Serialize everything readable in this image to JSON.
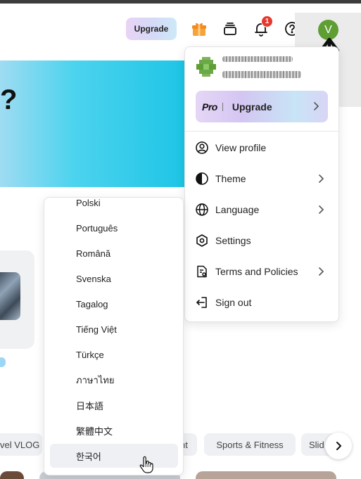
{
  "header": {
    "upgrade_label": "Upgrade",
    "notification_count": "1",
    "avatar_initial": "V",
    "icons": [
      "gift-icon",
      "wallet-icon",
      "bell-icon",
      "help-icon"
    ]
  },
  "background": {
    "hero_fragment": "?",
    "chips": [
      "vel VLOG",
      "nt",
      "Sports & Fitness",
      "Slid"
    ]
  },
  "profile_menu": {
    "pro_card": {
      "pro_label": "Pro",
      "upgrade_label": "Upgrade"
    },
    "items": [
      {
        "label": "View profile",
        "icon": "user-circle-icon",
        "has_submenu": false
      },
      {
        "label": "Theme",
        "icon": "theme-icon",
        "has_submenu": true
      },
      {
        "label": "Language",
        "icon": "globe-icon",
        "has_submenu": true
      },
      {
        "label": "Settings",
        "icon": "settings-hexagon-icon",
        "has_submenu": false
      },
      {
        "label": "Terms and Policies",
        "icon": "document-icon",
        "has_submenu": true
      },
      {
        "label": "Sign out",
        "icon": "sign-out-icon",
        "has_submenu": false
      }
    ]
  },
  "language_menu": {
    "items": [
      "Polski",
      "Português",
      "Română",
      "Svenska",
      "Tagalog",
      "Tiếng Việt",
      "Türkçe",
      "ภาษาไทย",
      "日本語",
      "繁體中文",
      "한국어"
    ],
    "hovered": "한국어"
  },
  "colors": {
    "avatar": "#5e9e33",
    "badge": "#e8372c",
    "hero_gradient_end": "#1ec5e6"
  }
}
